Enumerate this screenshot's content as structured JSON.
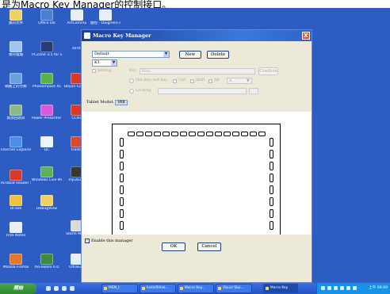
{
  "page_heading": "是为Macro Key Manager的控制接口。",
  "desktop": {
    "icons": [
      {
        "label": "我的文件"
      },
      {
        "label": "Office Ink"
      },
      {
        "label": "ArtCommu"
      },
      {
        "label": "捷徑 - DSignere.exe"
      },
      {
        "label": "我的電腦"
      },
      {
        "label": "PCZone 3.5 for VK700"
      },
      {
        "label": "stretch"
      },
      {
        "label": "網路上的芳鄰"
      },
      {
        "label": "PhotoImpact XL"
      },
      {
        "label": "Beyon Compa"
      },
      {
        "label": "資源回收筒"
      },
      {
        "label": "Power Presenter RE"
      },
      {
        "label": "CClea"
      },
      {
        "label": "Internet Explorer"
      },
      {
        "label": "QC"
      },
      {
        "label": "FlashF"
      },
      {
        "label": "Acrobat Reader 5.1"
      },
      {
        "label": "Windows Live Messenger"
      },
      {
        "label": "mp3Gain"
      },
      {
        "label": "Dr.exe"
      },
      {
        "label": "DebugView"
      },
      {
        "label": "Free Notes"
      },
      {
        "label": "Starts Menu"
      },
      {
        "label": "Mozilla Firefox"
      },
      {
        "label": "Ad-aware 6.0"
      },
      {
        "label": "UltraEdit"
      }
    ]
  },
  "dialog": {
    "title": "Macro Key Manager",
    "close_glyph": "X",
    "profile_select": "Default",
    "new_label": "New",
    "delete_label": "Delete",
    "key_select": "K1",
    "setting_label": "Setting",
    "key_label": "Key",
    "key_value": "Nou",
    "confirm_label": "Confirm",
    "hot_key_label": "Hot key: hot key",
    "ctrl_label": "Ctrl",
    "shift_label": "Shift",
    "alt_label": "Alt",
    "key_option": "A",
    "locking_label": "Locking",
    "tablet_model_label": "Tablet Model:",
    "tablet_model_value": "VK8",
    "enable_label": "Enable this manager",
    "ok_label": "OK",
    "cancel_label": "Cancel"
  },
  "taskbar": {
    "start_label": "開始",
    "buttons": [
      {
        "label": "MEM_t"
      },
      {
        "label": "InstallShiel..."
      },
      {
        "label": "Macro Key..."
      },
      {
        "label": "Visual Stui..."
      },
      {
        "label": "Macro Key"
      }
    ],
    "clock": "上午 09:49"
  },
  "colors": {
    "desktop": "#2d5dc2",
    "titlebar": "#2a5bc6",
    "dialog_face": "#ece9d8",
    "taskbar": "#2f62d4",
    "start": "#3a9a3a"
  }
}
